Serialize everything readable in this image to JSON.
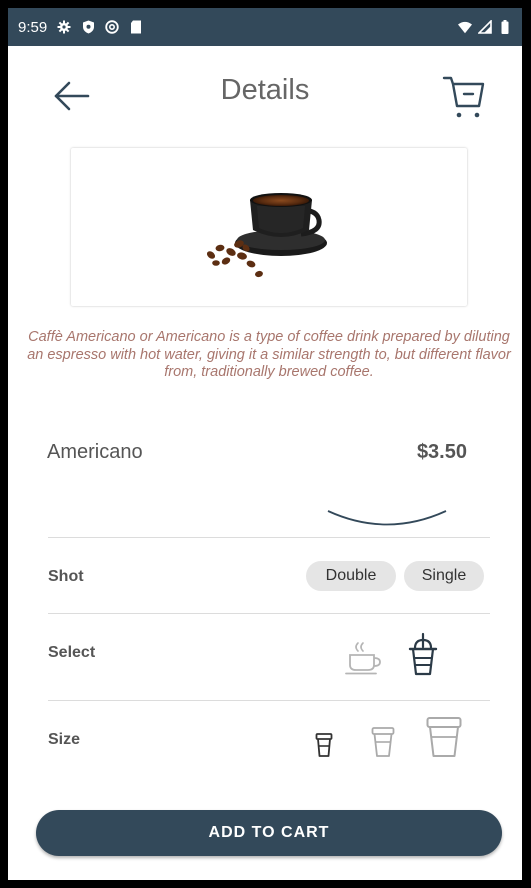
{
  "status_bar": {
    "time": "9:59"
  },
  "header": {
    "title": "Details"
  },
  "product": {
    "description": "Caffè Americano or Americano is a type of coffee drink prepared by diluting an espresso with hot water, giving it a similar strength to, but different flavor from, traditionally brewed coffee.",
    "name": "Americano",
    "price": "$3.50"
  },
  "options": {
    "shot": {
      "label": "Shot",
      "choices": [
        "Double",
        "Single"
      ]
    },
    "select": {
      "label": "Select",
      "choices": [
        "hot-cup-icon",
        "iced-cup-icon"
      ]
    },
    "size": {
      "label": "Size",
      "choices": [
        "small-cup-icon",
        "medium-cup-icon",
        "large-cup-icon"
      ]
    }
  },
  "cta": {
    "label": "ADD TO CART"
  },
  "colors": {
    "primary": "#33495a",
    "description_text": "#a8766d",
    "chip_bg": "#e5e5e5"
  }
}
